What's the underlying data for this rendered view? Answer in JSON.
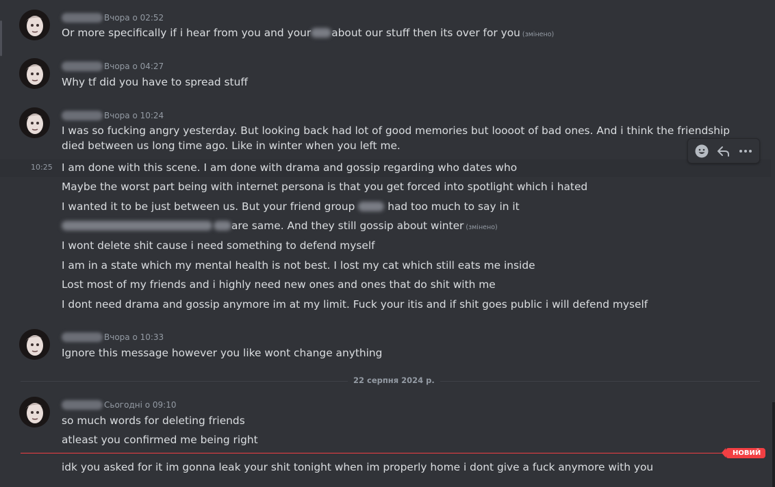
{
  "messages": [
    {
      "timestamp": "Вчора о 02:52",
      "lines": [
        {
          "before": "Or more specifically if i hear from you and your",
          "after": "about our stuff then its over for you",
          "edited": "(змінено)"
        }
      ]
    },
    {
      "timestamp": "Вчора о 04:27",
      "lines": [
        {
          "text": "Why tf did you have to spread stuff"
        }
      ]
    },
    {
      "timestamp": "Вчора о 10:24",
      "lines": [
        {
          "text": "I was so fucking angry yesterday. But looking back had lot of good memories but loooot of bad ones. And i think the friendship died between us long time ago. Like in winter when you left me."
        },
        {
          "text": "I am done with this scene. I am done with drama and gossip regarding who dates who",
          "hover_time": "10:25"
        },
        {
          "text": "Maybe the worst part being with internet persona is that you get forced into spotlight which i hated"
        },
        {
          "before": "I wanted it to be just between us. But your friend group",
          "after": "had too much to say in it"
        },
        {
          "after": "are same. And they still gossip about winter",
          "edited": "(змінено)"
        },
        {
          "text": "I wont delete shit cause i need something to defend myself"
        },
        {
          "text": "I am in a state which my mental health is not best. I lost my cat which still eats me inside"
        },
        {
          "text": "Lost most of my friends and i highly need new ones and ones that do shit with me"
        },
        {
          "text": "I dont need drama and gossip anymore im at my limit. Fuck your itis and if shit goes public i will defend myself"
        }
      ]
    },
    {
      "timestamp": "Вчора о 10:33",
      "lines": [
        {
          "text": "Ignore this message however you like wont change anything"
        }
      ]
    },
    {
      "timestamp": "Сьогодні о 09:10",
      "lines": [
        {
          "text": "so much words for deleting friends"
        },
        {
          "text": "atleast you confirmed me being right"
        },
        {
          "text": "idk you asked for it im gonna leak your shit tonight when im properly home i dont give a fuck anymore with you"
        }
      ]
    }
  ],
  "date_divider": "22 серпня 2024 р.",
  "new_badge": "НОВИЙ",
  "toolbar": {
    "icons": [
      "add-reaction-icon",
      "reply-icon",
      "more-options-icon"
    ]
  },
  "colors": {
    "background": "#313338",
    "text": "#dbdee1",
    "muted": "#949ba4",
    "new_marker": "#f23f43"
  }
}
